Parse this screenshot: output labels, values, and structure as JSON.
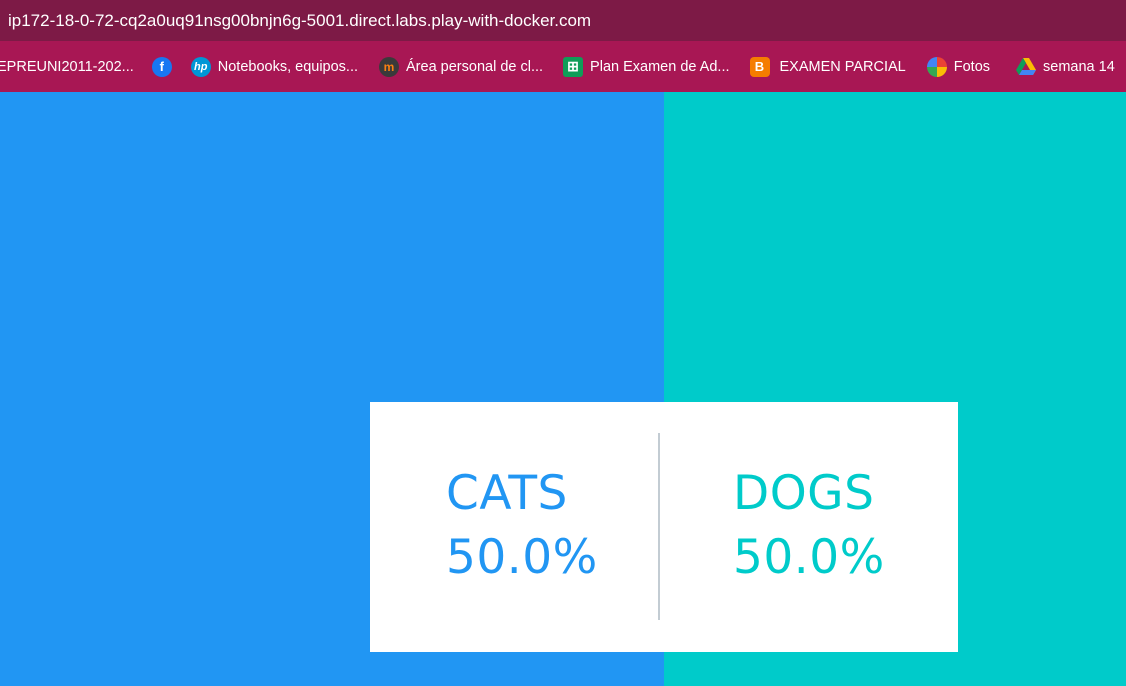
{
  "browser": {
    "url": "ip172-18-0-72-cq2a0uq91nsg00bnjn6g-5001.direct.labs.play-with-docker.com",
    "bookmarks": [
      {
        "label": "EPREUNI2011-202...",
        "icon": "none"
      },
      {
        "label": "",
        "icon": "facebook-icon"
      },
      {
        "label": "Notebooks, equipos...",
        "icon": "hp-icon"
      },
      {
        "label": "Área personal de cl...",
        "icon": "moodle-icon"
      },
      {
        "label": "Plan Examen de Ad...",
        "icon": "google-sheets-icon"
      },
      {
        "label": "EXAMEN PARCIAL",
        "icon": "blogger-icon"
      },
      {
        "label": "Fotos",
        "icon": "google-photos-icon"
      },
      {
        "label": "semana 14",
        "icon": "google-drive-icon"
      }
    ]
  },
  "colors": {
    "cats": "#2196f3",
    "dogs": "#00cbca",
    "urlbar": "#7d1a46",
    "bookmarks_bar": "#a81754"
  },
  "results": {
    "cats": {
      "label": "CATS",
      "percent": "50.0%"
    },
    "dogs": {
      "label": "DOGS",
      "percent": "50.0%"
    }
  }
}
